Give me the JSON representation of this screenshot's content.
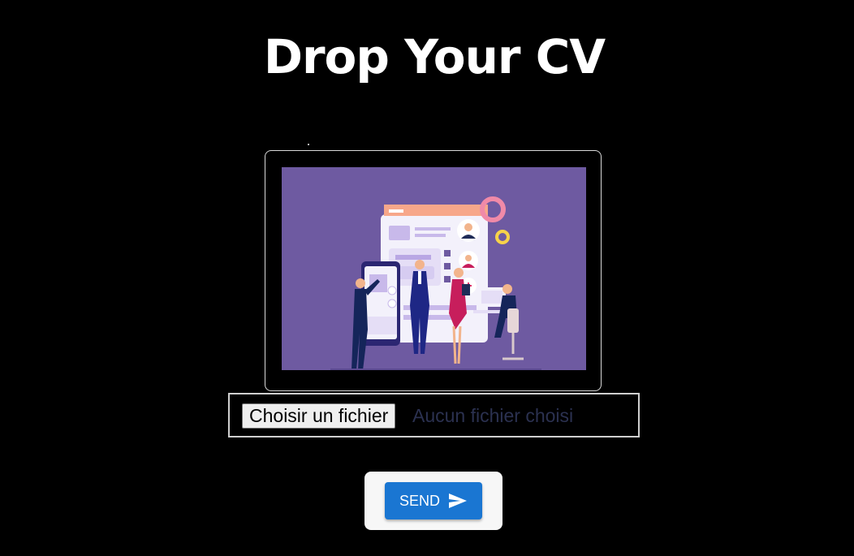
{
  "page": {
    "title": "Drop Your CV"
  },
  "upload": {
    "illustration": "recruitment-team-illustration",
    "file_button_label": "Choisir un fichier",
    "file_status": "Aucun fichier choisi"
  },
  "actions": {
    "send_label": "SEND",
    "send_icon": "send-icon"
  },
  "colors": {
    "background": "#000000",
    "illustration_bg": "#6e5aa1",
    "send_button": "#1a76d2"
  }
}
